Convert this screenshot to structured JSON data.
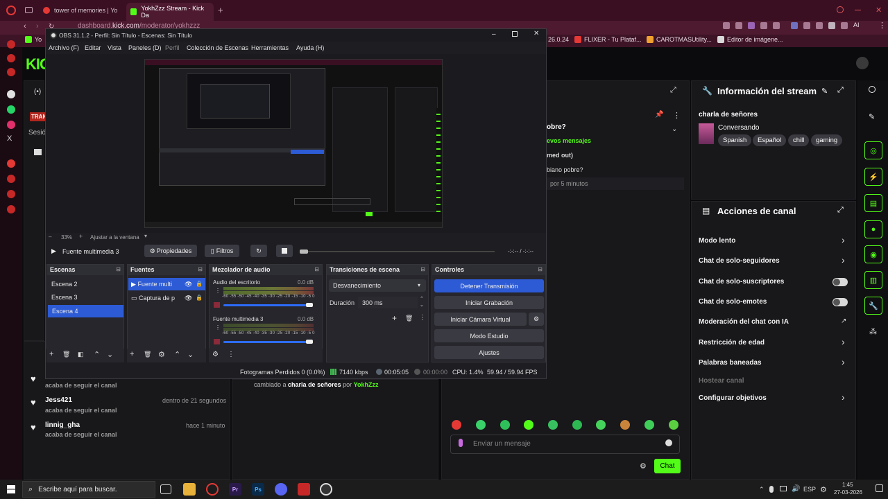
{
  "browser": {
    "tabs": [
      {
        "title": "tower of memories | Yo",
        "color": "#e53935"
      },
      {
        "title": "YokhZzz Stream - Kick Da",
        "color": "#53fc18"
      }
    ],
    "new_tab": "+",
    "url_prefix": "dashboard.",
    "url_domain": "kick.com",
    "url_path": "/moderator/yokhzzz",
    "bookmarks": [
      "26.0.24",
      "FLIXER - Tu Plataf...",
      "CAROTMASUtility...",
      "Editor de imágene..."
    ],
    "ai_label": "AI"
  },
  "kick": {
    "logo": "KICK",
    "left_truncated": [
      "TRAN",
      "Sesió"
    ],
    "stream_info": {
      "title": "Información del stream",
      "stream_title": "charla de señores",
      "category": "Conversando",
      "tags": [
        "Spanish",
        "Español",
        "chill",
        "gaming"
      ]
    },
    "chat_peek": {
      "line1": "obre?",
      "line2": "evos mensajes",
      "line3": "med out)",
      "line4": "biano pobre?",
      "line5": "por 5 minutos"
    },
    "channel_actions": {
      "title": "Acciones de canal",
      "items": [
        {
          "label": "Modo lento",
          "control": "chevron"
        },
        {
          "label": "Chat de solo-seguidores",
          "control": "chevron"
        },
        {
          "label": "Chat de solo-suscriptores",
          "control": "toggle"
        },
        {
          "label": "Chat de solo-emotes",
          "control": "toggle"
        },
        {
          "label": "Moderación del chat con IA",
          "control": "external"
        },
        {
          "label": "Restricción de edad",
          "control": "chevron"
        },
        {
          "label": "Palabras baneadas",
          "control": "chevron"
        },
        {
          "label": "Hostear canal",
          "control": "none"
        },
        {
          "label": "Configurar objetivos",
          "control": "chevron"
        }
      ]
    },
    "activity": [
      {
        "user": "",
        "time": "",
        "action": "acaba de seguir el canal"
      },
      {
        "user": "Jess421",
        "time": "dentro de 21 segundos",
        "action": "acaba de seguir el canal"
      },
      {
        "user": "linnig_gha",
        "time": "hace 1 minuto",
        "action": "acaba de seguir el canal"
      }
    ],
    "mod_log": {
      "prefix": "cambiado a",
      "title": "charla de señores",
      "by": "por",
      "user": "YokhZzz"
    },
    "chat_input_placeholder": "Enviar un mensaje",
    "chat_button": "Chat"
  },
  "obs": {
    "window_title": "OBS 31.1.2 - Perfil: Sin Título - Escenas: Sin Título",
    "menu": [
      "Archivo (F)",
      "Editar",
      "Vista",
      "Paneles (D)",
      "Perfil",
      "Colección de Escenas",
      "Herramientas",
      "Ayuda (H)"
    ],
    "zoom": "33%",
    "fit_label": "Ajustar a la ventana",
    "source_bar": {
      "name": "Fuente multimedia 3",
      "props": "Propiedades",
      "filters": "Filtros",
      "time": "-:-:-- / -:-:--"
    },
    "docks": {
      "scenes": {
        "title": "Escenas",
        "items": [
          "Escena 2",
          "Escena 3",
          "Escena 4"
        ],
        "selected": 2
      },
      "sources": {
        "title": "Fuentes",
        "items": [
          "Fuente multi",
          "Captura de p"
        ]
      },
      "mixer": {
        "title": "Mezclador de audio",
        "channels": [
          {
            "name": "Audio del escritorio",
            "db": "0.0 dB"
          },
          {
            "name": "Fuente multimedia 3",
            "db": "0.0 dB"
          }
        ],
        "ticks": "-60 -55 -50 -45 -40 -35 -30 -25 -20 -15 -10 -5 0"
      },
      "transitions": {
        "title": "Transiciones de escena",
        "selected": "Desvanecimiento",
        "duration_label": "Duración",
        "duration_value": "300 ms"
      },
      "controls": {
        "title": "Controles",
        "buttons": [
          "Detener Transmisión",
          "Iniciar Grabación",
          "Iniciar Cámara Virtual",
          "Modo Estudio",
          "Ajustes"
        ]
      }
    },
    "status": {
      "dropped": "Fotogramas Perdidos 0 (0.0%)",
      "bitrate": "7140 kbps",
      "live_time": "00:05:05",
      "rec_time": "00:00:00",
      "cpu": "CPU: 1.4%",
      "fps": "59.94 / 59.94 FPS"
    }
  },
  "taskbar": {
    "search_placeholder": "Escribe aquí para buscar.",
    "lang": "ESP",
    "time": "1:45",
    "date": "27-03-2026"
  },
  "colors": {
    "kick_green": "#53fc18",
    "obs_blue": "#2d5bd6",
    "panel": "#18181b"
  }
}
